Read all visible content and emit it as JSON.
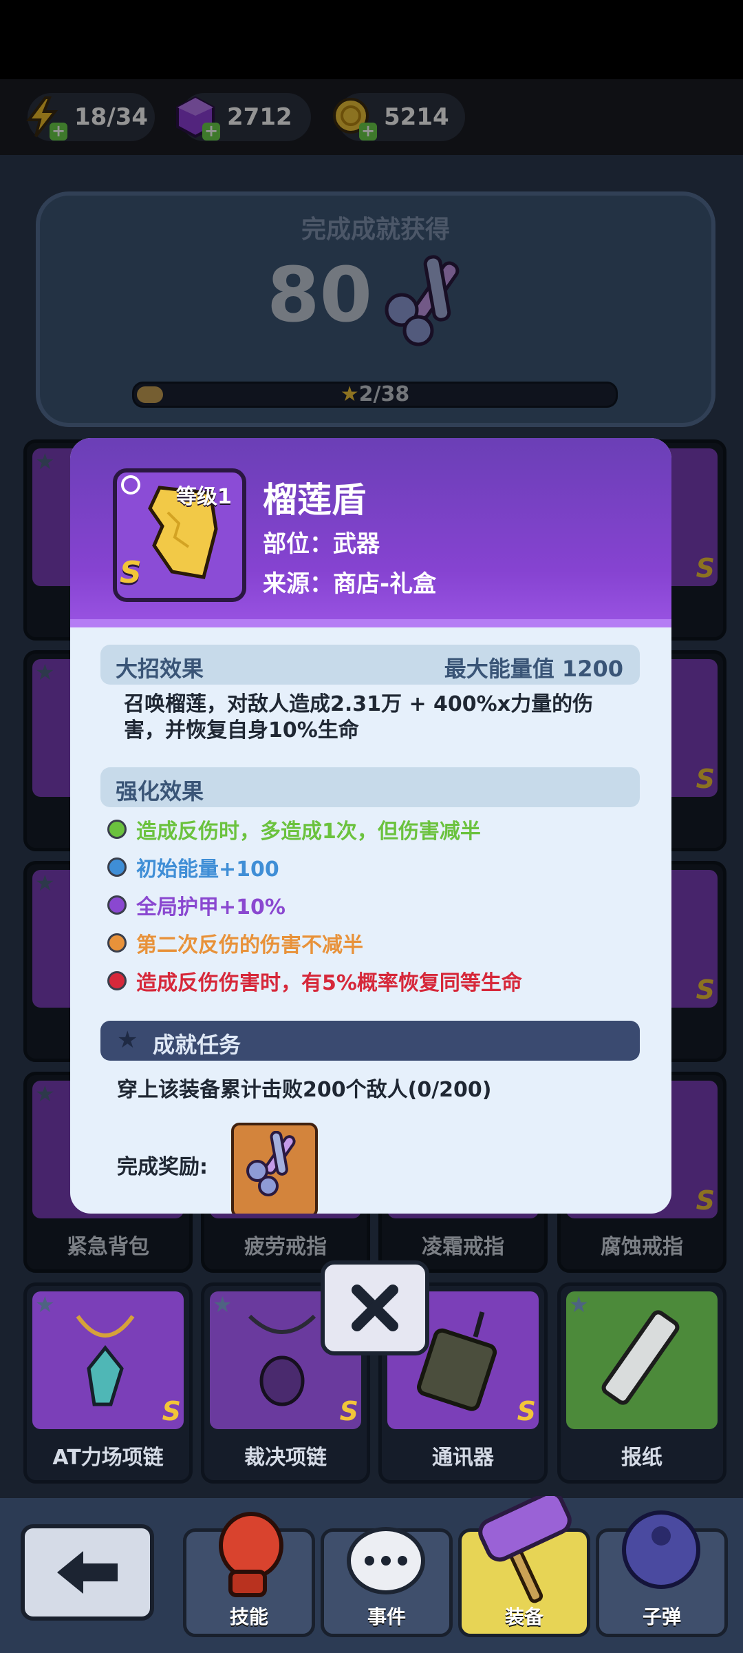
{
  "resources": {
    "energy": "18/34",
    "gems": "2712",
    "coins": "5214"
  },
  "achievement": {
    "title": "完成成就获得",
    "value": "80",
    "progress_text": "2/38",
    "progress": 0.053
  },
  "grid_labels": {
    "row3": [
      "紧急背包",
      "疲劳戒指",
      "凌霜戒指",
      "腐蚀戒指"
    ],
    "row4": [
      "AT力场项链",
      "裁决项链",
      "通讯器",
      "报纸"
    ],
    "rank": "S"
  },
  "modal": {
    "level": "等级1",
    "rank": "S",
    "name": "榴莲盾",
    "slot": "部位：武器",
    "source": "来源：商店-礼盒",
    "ult_label": "大招效果",
    "max_energy": "最大能量值 1200",
    "ult_desc_1": "召唤榴莲，对敌人造成2.31万 + 400%x力量的伤",
    "ult_desc_2": "害，并恢复自身10%生命",
    "enhance_label": "强化效果",
    "enhancements": [
      {
        "text": "造成反伤时，多造成1次，但伤害减半",
        "color": "#6bc23e"
      },
      {
        "text": "初始能量+100",
        "color": "#3f8ed6"
      },
      {
        "text": "全局护甲+10%",
        "color": "#8a48d0"
      },
      {
        "text": "第二次反伤的伤害不减半",
        "color": "#e8923a"
      },
      {
        "text": "造成反伤伤害时，有5%概率恢复同等生命",
        "color": "#d6283a"
      }
    ],
    "task_label": "成就任务",
    "task_desc": "穿上该装备累计击败200个敌人(0/200)",
    "reward_label": "完成奖励:"
  },
  "nav": {
    "tabs": [
      "技能",
      "事件",
      "装备",
      "子弹"
    ]
  }
}
